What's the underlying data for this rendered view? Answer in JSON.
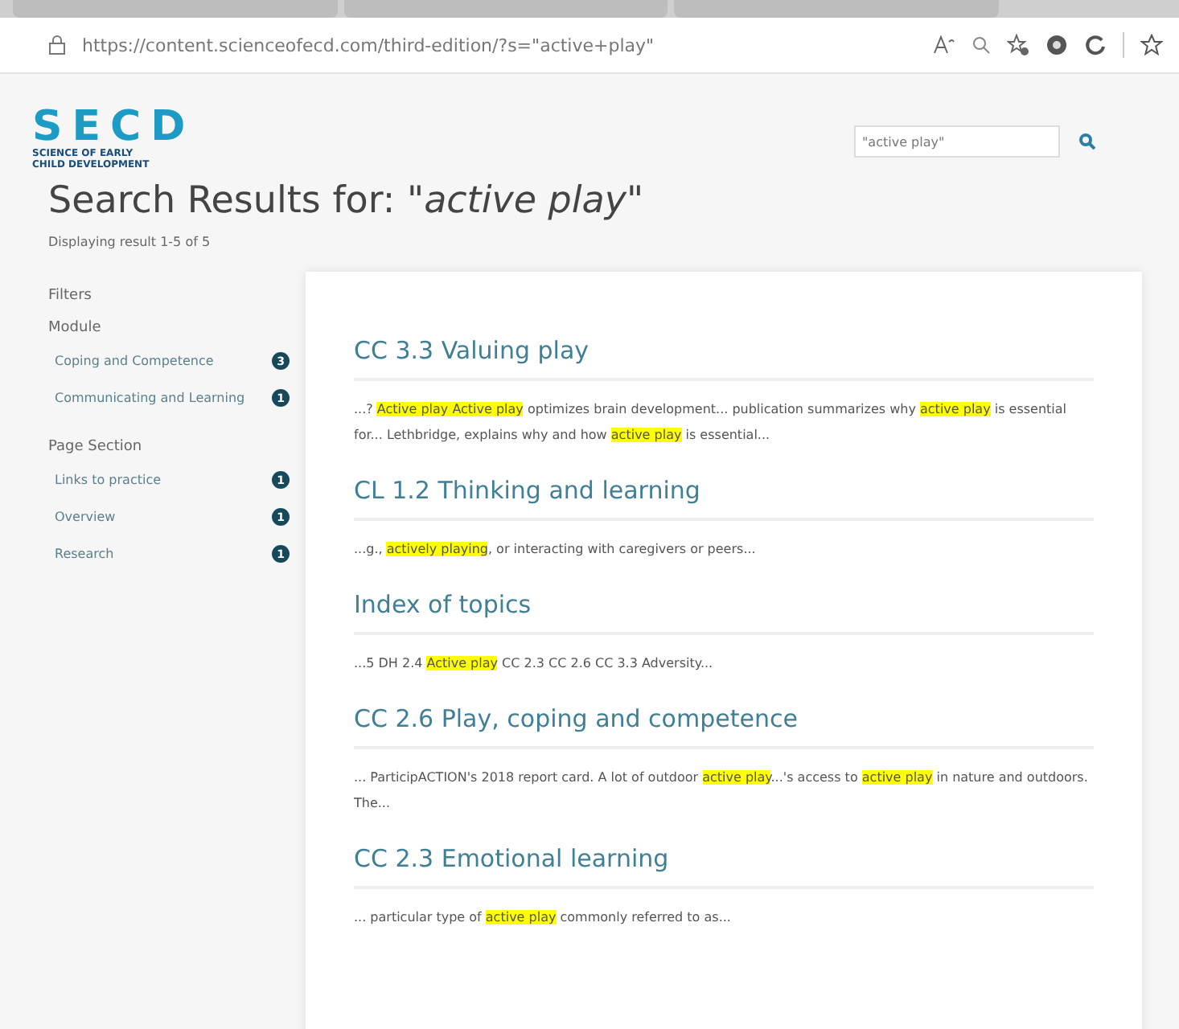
{
  "browser": {
    "url_host": "https://content.scienceofecd.com",
    "url_path": "/third-edition/?s=\"active+play\""
  },
  "site": {
    "logo": "SECD",
    "logo_subtitle": "SCIENCE OF EARLY CHILD DEVELOPMENT",
    "search": {
      "value": "\"active play\""
    }
  },
  "heading": "Search Results for: *\"active play\"*",
  "result_count": "Displaying result 1-5 of 5",
  "filters": {
    "title": "Filters",
    "groups": [
      {
        "title": "Module",
        "items": [
          {
            "label": "Coping and Competence",
            "count": "3"
          },
          {
            "label": "Communicating and Learning",
            "count": "1"
          }
        ]
      },
      {
        "title": "Page Section",
        "items": [
          {
            "label": "Links to practice",
            "count": "1"
          },
          {
            "label": "Overview",
            "count": "1"
          },
          {
            "label": "Research",
            "count": "1"
          }
        ]
      }
    ]
  },
  "results": [
    {
      "title": "CC 3.3 Valuing play",
      "snippet": [
        {
          "text": "...? ",
          "highlighted": false
        },
        {
          "text": "Active play Active play",
          "highlighted": true
        },
        {
          "text": " optimizes brain development... publication summarizes why ",
          "highlighted": false
        },
        {
          "text": "active play",
          "highlighted": true
        },
        {
          "text": " is essential for... Lethbridge, explains why and how ",
          "highlighted": false
        },
        {
          "text": "active play",
          "highlighted": true
        },
        {
          "text": " is essential...",
          "highlighted": false
        }
      ]
    },
    {
      "title": "CL 1.2 Thinking and learning",
      "snippet": [
        {
          "text": "...g., ",
          "highlighted": false
        },
        {
          "text": "actively playing",
          "highlighted": true
        },
        {
          "text": ", or interacting with caregivers or peers...",
          "highlighted": false
        }
      ]
    },
    {
      "title": "Index of topics",
      "snippet": [
        {
          "text": "...5 DH 2.4 ",
          "highlighted": false
        },
        {
          "text": "Active play",
          "highlighted": true
        },
        {
          "text": " CC 2.3 CC 2.6 CC 3.3 Adversity...",
          "highlighted": false
        }
      ]
    },
    {
      "title": "CC 2.6 Play, coping and competence",
      "snippet": [
        {
          "text": "... ParticipACTION's 2018 report card. A lot of outdoor ",
          "highlighted": false
        },
        {
          "text": "active play",
          "highlighted": true
        },
        {
          "text": "...'s access to ",
          "highlighted": false
        },
        {
          "text": "active play",
          "highlighted": true
        },
        {
          "text": " in nature and outdoors.  The...",
          "highlighted": false
        }
      ]
    },
    {
      "title": "CC 2.3 Emotional learning",
      "snippet": [
        {
          "text": "... particular type of ",
          "highlighted": false
        },
        {
          "text": "active play",
          "highlighted": true
        },
        {
          "text": " commonly referred to as...",
          "highlighted": false
        }
      ]
    }
  ]
}
